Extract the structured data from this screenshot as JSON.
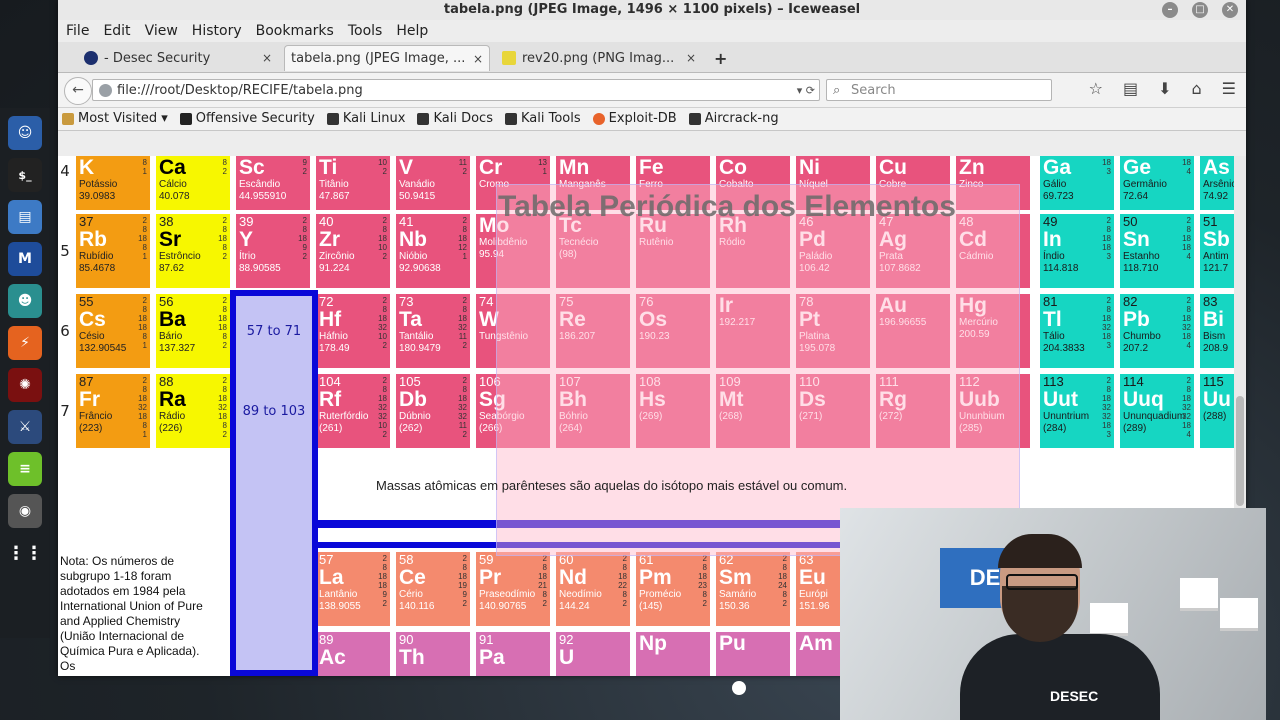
{
  "window": {
    "title": "tabela.png (JPEG Image, 1496 × 1100 pixels) – Iceweasel"
  },
  "menu": [
    "File",
    "Edit",
    "View",
    "History",
    "Bookmarks",
    "Tools",
    "Help"
  ],
  "tabs": [
    {
      "label": "- Desec Security",
      "close": "×"
    },
    {
      "label": "tabela.png (JPEG Image, ...",
      "close": "×"
    },
    {
      "label": "rev20.png (PNG Imag...",
      "close": "×"
    }
  ],
  "new_tab": "+",
  "nav": {
    "url": "file:///root/Desktop/RECIFE/tabela.png",
    "search_placeholder": "Search"
  },
  "bookmarks": [
    "Most Visited ▾",
    "Offensive Security",
    "Kali Linux",
    "Kali Docs",
    "Kali Tools",
    "Exploit-DB",
    "Aircrack-ng"
  ],
  "image": {
    "overlay_title": "Tabela Periódica dos Elementos",
    "caption": "Massas atômicas em parênteses são aquelas do isótopo mais estável ou comum.",
    "note": "Nota: Os números de subgrupo 1-18 foram adotados em 1984 pela International Union of Pure and Applied Chemistry (União Internacional de Química Pura e Aplicada). Os",
    "range_lanthanides": "57 to 71",
    "range_actinides": "89 to 103",
    "periods": [
      "4",
      "5",
      "6",
      "7"
    ],
    "elements": [
      {
        "num": "",
        "sym": "K",
        "name": "Potássio",
        "mass": "39.0983",
        "shells": "8\n1"
      },
      {
        "num": "",
        "sym": "Ca",
        "name": "Cálcio",
        "mass": "40.078",
        "shells": "8\n2"
      },
      {
        "num": "",
        "sym": "Sc",
        "name": "Escândio",
        "mass": "44.955910",
        "shells": "9\n2"
      },
      {
        "num": "",
        "sym": "Ti",
        "name": "Titânio",
        "mass": "47.867",
        "shells": "10\n2"
      },
      {
        "num": "",
        "sym": "V",
        "name": "Vanádio",
        "mass": "50.9415",
        "shells": "11\n2"
      },
      {
        "num": "",
        "sym": "Cr",
        "name": "Cromo",
        "mass": "",
        "shells": "13\n1"
      },
      {
        "num": "",
        "sym": "Mn",
        "name": "Manganês",
        "mass": "",
        "shells": ""
      },
      {
        "num": "",
        "sym": "Fe",
        "name": "Ferro",
        "mass": "",
        "shells": ""
      },
      {
        "num": "",
        "sym": "Co",
        "name": "Cobalto",
        "mass": "",
        "shells": ""
      },
      {
        "num": "",
        "sym": "Ni",
        "name": "Níquel",
        "mass": "",
        "shells": ""
      },
      {
        "num": "",
        "sym": "Cu",
        "name": "Cobre",
        "mass": "",
        "shells": ""
      },
      {
        "num": "",
        "sym": "Zn",
        "name": "Zinco",
        "mass": "",
        "shells": ""
      },
      {
        "num": "",
        "sym": "Ga",
        "name": "Gálio",
        "mass": "69.723",
        "shells": "18\n3"
      },
      {
        "num": "",
        "sym": "Ge",
        "name": "Germânio",
        "mass": "72.64",
        "shells": "18\n4"
      },
      {
        "num": "",
        "sym": "As",
        "name": "Arsênio",
        "mass": "74.92",
        "shells": ""
      },
      {
        "num": "37",
        "sym": "Rb",
        "name": "Rubídio",
        "mass": "85.4678",
        "shells": "2\n8\n18\n8\n1"
      },
      {
        "num": "38",
        "sym": "Sr",
        "name": "Estrôncio",
        "mass": "87.62",
        "shells": "2\n8\n18\n8\n2"
      },
      {
        "num": "39",
        "sym": "Y",
        "name": "Ítrio",
        "mass": "88.90585",
        "shells": "2\n8\n18\n9\n2"
      },
      {
        "num": "40",
        "sym": "Zr",
        "name": "Zircônio",
        "mass": "91.224",
        "shells": "2\n8\n18\n10\n2"
      },
      {
        "num": "41",
        "sym": "Nb",
        "name": "Nióbio",
        "mass": "92.90638",
        "shells": "2\n8\n18\n12\n1"
      },
      {
        "num": "",
        "sym": "Mo",
        "name": "Molibdênio",
        "mass": "95.94",
        "shells": ""
      },
      {
        "num": "",
        "sym": "Tc",
        "name": "Tecnécio",
        "mass": "(98)",
        "shells": ""
      },
      {
        "num": "",
        "sym": "Ru",
        "name": "Rutênio",
        "mass": "",
        "shells": ""
      },
      {
        "num": "",
        "sym": "Rh",
        "name": "Ródio",
        "mass": "",
        "shells": ""
      },
      {
        "num": "46",
        "sym": "Pd",
        "name": "Paládio",
        "mass": "106.42",
        "shells": ""
      },
      {
        "num": "47",
        "sym": "Ag",
        "name": "Prata",
        "mass": "107.8682",
        "shells": ""
      },
      {
        "num": "48",
        "sym": "Cd",
        "name": "Cádmio",
        "mass": "",
        "shells": ""
      },
      {
        "num": "49",
        "sym": "In",
        "name": "Índio",
        "mass": "114.818",
        "shells": "2\n8\n18\n18\n3"
      },
      {
        "num": "50",
        "sym": "Sn",
        "name": "Estanho",
        "mass": "118.710",
        "shells": "2\n8\n18\n18\n4"
      },
      {
        "num": "51",
        "sym": "Sb",
        "name": "Antim",
        "mass": "121.7",
        "shells": ""
      },
      {
        "num": "55",
        "sym": "Cs",
        "name": "Césio",
        "mass": "132.90545",
        "shells": "2\n8\n18\n18\n8\n1"
      },
      {
        "num": "56",
        "sym": "Ba",
        "name": "Bário",
        "mass": "137.327",
        "shells": "2\n8\n18\n18\n8\n2"
      },
      {
        "num": "72",
        "sym": "Hf",
        "name": "Háfnio",
        "mass": "178.49",
        "shells": "2\n8\n18\n32\n10\n2"
      },
      {
        "num": "73",
        "sym": "Ta",
        "name": "Tantálio",
        "mass": "180.9479",
        "shells": "2\n8\n18\n32\n11\n2"
      },
      {
        "num": "74",
        "sym": "W",
        "name": "Tungstênio",
        "mass": "",
        "shells": ""
      },
      {
        "num": "75",
        "sym": "Re",
        "name": "",
        "mass": "186.207",
        "shells": ""
      },
      {
        "num": "76",
        "sym": "Os",
        "name": "",
        "mass": "190.23",
        "shells": ""
      },
      {
        "num": "",
        "sym": "Ir",
        "name": "",
        "mass": "192.217",
        "shells": ""
      },
      {
        "num": "78",
        "sym": "Pt",
        "name": "Platina",
        "mass": "195.078",
        "shells": ""
      },
      {
        "num": "",
        "sym": "Au",
        "name": "",
        "mass": "196.96655",
        "shells": ""
      },
      {
        "num": "",
        "sym": "Hg",
        "name": "Mercúrio",
        "mass": "200.59",
        "shells": ""
      },
      {
        "num": "81",
        "sym": "Tl",
        "name": "Tálio",
        "mass": "204.3833",
        "shells": "2\n8\n18\n32\n18\n3"
      },
      {
        "num": "82",
        "sym": "Pb",
        "name": "Chumbo",
        "mass": "207.2",
        "shells": "2\n8\n18\n32\n18\n4"
      },
      {
        "num": "83",
        "sym": "Bi",
        "name": "Bism",
        "mass": "208.9",
        "shells": ""
      },
      {
        "num": "87",
        "sym": "Fr",
        "name": "Frâncio",
        "mass": "(223)",
        "shells": "2\n8\n18\n32\n18\n8\n1"
      },
      {
        "num": "88",
        "sym": "Ra",
        "name": "Rádio",
        "mass": "(226)",
        "shells": "2\n8\n18\n32\n18\n8\n2"
      },
      {
        "num": "104",
        "sym": "Rf",
        "name": "Ruterfórdio",
        "mass": "(261)",
        "shells": "2\n8\n18\n32\n32\n10\n2"
      },
      {
        "num": "105",
        "sym": "Db",
        "name": "Dúbnio",
        "mass": "(262)",
        "shells": "2\n8\n18\n32\n32\n11\n2"
      },
      {
        "num": "106",
        "sym": "Sg",
        "name": "Seabórgio",
        "mass": "(266)",
        "shells": ""
      },
      {
        "num": "107",
        "sym": "Bh",
        "name": "Bóhrio",
        "mass": "(264)",
        "shells": ""
      },
      {
        "num": "108",
        "sym": "Hs",
        "name": "",
        "mass": "(269)",
        "shells": ""
      },
      {
        "num": "109",
        "sym": "Mt",
        "name": "",
        "mass": "(268)",
        "shells": ""
      },
      {
        "num": "110",
        "sym": "Ds",
        "name": "",
        "mass": "(271)",
        "shells": ""
      },
      {
        "num": "111",
        "sym": "Rg",
        "name": "",
        "mass": "(272)",
        "shells": ""
      },
      {
        "num": "112",
        "sym": "Uub",
        "name": "Ununbium",
        "mass": "(285)",
        "shells": ""
      },
      {
        "num": "113",
        "sym": "Uut",
        "name": "Ununtrium",
        "mass": "(284)",
        "shells": "2\n8\n18\n32\n32\n18\n3"
      },
      {
        "num": "114",
        "sym": "Uuq",
        "name": "Ununquadium",
        "mass": "(289)",
        "shells": "2\n8\n18\n32\n32\n18\n4"
      },
      {
        "num": "115",
        "sym": "Uu",
        "name": "",
        "mass": "(288)",
        "shells": ""
      },
      {
        "num": "57",
        "sym": "La",
        "name": "Lantânio",
        "mass": "138.9055",
        "shells": "2\n8\n18\n18\n9\n2"
      },
      {
        "num": "58",
        "sym": "Ce",
        "name": "Cério",
        "mass": "140.116",
        "shells": "2\n8\n18\n19\n9\n2"
      },
      {
        "num": "59",
        "sym": "Pr",
        "name": "Praseodímio",
        "mass": "140.90765",
        "shells": "2\n8\n18\n21\n8\n2"
      },
      {
        "num": "60",
        "sym": "Nd",
        "name": "Neodímio",
        "mass": "144.24",
        "shells": "2\n8\n18\n22\n8\n2"
      },
      {
        "num": "61",
        "sym": "Pm",
        "name": "Promécio",
        "mass": "(145)",
        "shells": "2\n8\n18\n23\n8\n2"
      },
      {
        "num": "62",
        "sym": "Sm",
        "name": "Samário",
        "mass": "150.36",
        "shells": "2\n8\n18\n24\n8\n2"
      },
      {
        "num": "63",
        "sym": "Eu",
        "name": "Európi",
        "mass": "151.96",
        "shells": ""
      },
      {
        "num": "89",
        "sym": "Ac",
        "name": "",
        "mass": "",
        "shells": ""
      },
      {
        "num": "90",
        "sym": "Th",
        "name": "",
        "mass": "",
        "shells": ""
      },
      {
        "num": "91",
        "sym": "Pa",
        "name": "",
        "mass": "",
        "shells": ""
      },
      {
        "num": "92",
        "sym": "U",
        "name": "",
        "mass": "",
        "shells": ""
      },
      {
        "num": "",
        "sym": "Np",
        "name": "",
        "mass": "",
        "shells": ""
      },
      {
        "num": "",
        "sym": "Pu",
        "name": "",
        "mass": "",
        "shells": ""
      },
      {
        "num": "",
        "sym": "Am",
        "name": "",
        "mass": "",
        "shells": ""
      }
    ]
  },
  "dock": [
    "Desec",
    "$_",
    "Files",
    "Metasploit",
    "Armitage",
    "Burp",
    "Beef",
    "Faraday",
    "Leafpad",
    "Apps",
    "Show Apps"
  ],
  "webcam": {
    "tv_text": "DE",
    "shirt_text": "DESEC"
  },
  "colors": {
    "alkali": "#f39c12",
    "earth": "#f7f700",
    "transition": "#e8537d",
    "post_transition": "#16d6c2",
    "lanthanide": "#f48a6e",
    "actinide": "#d76fb3",
    "block_border": "#0a08d8"
  }
}
